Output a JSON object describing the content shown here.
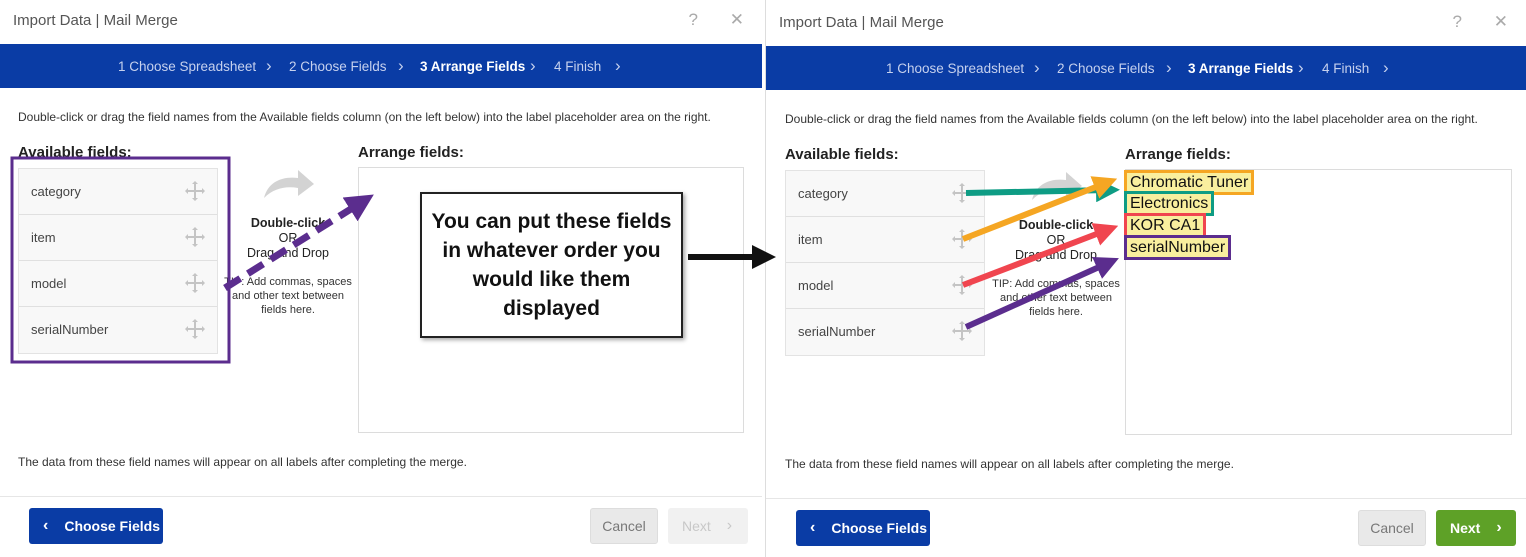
{
  "dialog": {
    "title": "Import Data | Mail Merge",
    "help_glyph": "?",
    "close_glyph": "✕"
  },
  "steps": [
    {
      "label": "1 Choose Spreadsheet",
      "active": false
    },
    {
      "label": "2 Choose Fields",
      "active": false
    },
    {
      "label": "3 Arrange Fields",
      "active": true
    },
    {
      "label": "4 Finish",
      "active": false
    }
  ],
  "instructions": "Double-click or drag the field names from the Available fields column (on the left below) into the label placeholder area on the right.",
  "available_heading": "Available fields:",
  "arrange_heading": "Arrange fields:",
  "fields": [
    "category",
    "item",
    "model",
    "serialNumber"
  ],
  "hint": {
    "line1": "Double-click",
    "line2": "OR",
    "line3": "Drag and Drop",
    "tip": "TIP: Add commas, spaces and other text between fields here."
  },
  "bottom_note": "The data from these field names will appear on all labels after completing the merge.",
  "buttons": {
    "back": "Choose Fields",
    "cancel": "Cancel",
    "next": "Next"
  },
  "callout": "You can put these fields in whatever order you would like them displayed",
  "arranged_fields": [
    "Chromatic Tuner",
    "Electronics",
    "KOR CA1",
    "serialNumber"
  ],
  "colors": {
    "step_bar": "#0a3ca5",
    "back_button": "#0a3ca5",
    "next_enabled": "#5ea127",
    "annotation_purple": "#5b2d8e",
    "annotation_orange": "#f5a623",
    "annotation_teal": "#0e9c84",
    "annotation_red": "#f0454f",
    "highlight_yellow": "#f9ef9e"
  }
}
